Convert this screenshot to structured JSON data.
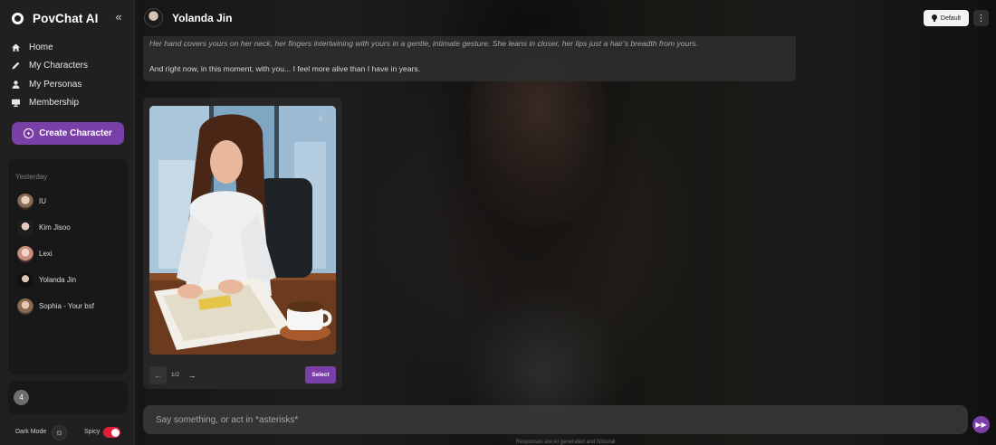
{
  "brand": {
    "name": "PovChat AI"
  },
  "nav": [
    {
      "label": "Home",
      "icon": "home-icon"
    },
    {
      "label": "My Characters",
      "icon": "pencil-icon"
    },
    {
      "label": "My Personas",
      "icon": "person-icon"
    },
    {
      "label": "Membership",
      "icon": "monitor-icon"
    }
  ],
  "create_button": "Create Character",
  "recent": {
    "heading": "Yesterday",
    "items": [
      {
        "name": "IU"
      },
      {
        "name": "Kim Jisoo"
      },
      {
        "name": "Lexi"
      },
      {
        "name": "Yolanda Jin"
      },
      {
        "name": "Sophia - Your bsf"
      }
    ]
  },
  "credits": "4",
  "settings": {
    "dark_mode_label": "Dark Mode",
    "spicy_label": "Spicy",
    "spicy_on": true
  },
  "header": {
    "character_name": "Yolanda Jin",
    "model_label": "Default"
  },
  "message": {
    "italic": "Her hand covers yours on her neck, her fingers intertwining with yours in a gentle, intimate gesture. She leans in closer, her lips just a hair's breadth from yours.",
    "text": "And right now, in this moment, with you... I feel more alive than I have in years."
  },
  "image_card": {
    "page": "1/2",
    "select_label": "Select"
  },
  "composer": {
    "placeholder": "Say something, or act in *asterisks*"
  },
  "disclaimer": "Responses are AI generated and fictional",
  "colors": {
    "accent": "#7b3fa8",
    "spicy_toggle": "#e01f3a",
    "sidebar_bg": "#202020"
  }
}
